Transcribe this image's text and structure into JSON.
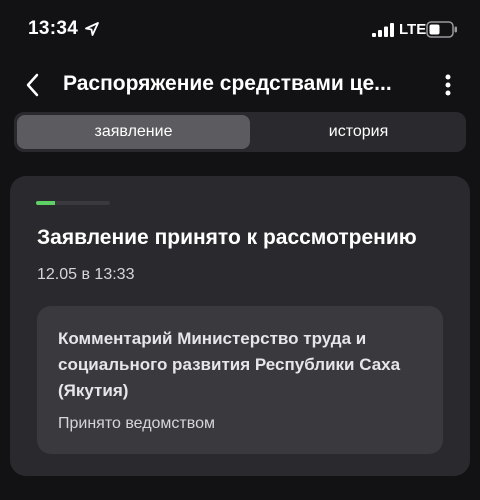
{
  "status_bar": {
    "time": "13:34",
    "network": "LTE"
  },
  "nav": {
    "title": "Распоряжение средствами це...",
    "back_icon": "chevron-left-icon",
    "more_icon": "more-vertical-icon"
  },
  "tabs": [
    {
      "label": "заявление",
      "active": true
    },
    {
      "label": "история",
      "active": false
    }
  ],
  "card": {
    "progress": 0.25,
    "progress_color": "#5fd065",
    "title": "Заявление принято к рассмотрению",
    "date": "12.05 в 13:33",
    "comment": {
      "title": "Комментарий Министерство труда и социального развития Республики Саха (Якутия)",
      "text": "Принято ведомством"
    }
  }
}
